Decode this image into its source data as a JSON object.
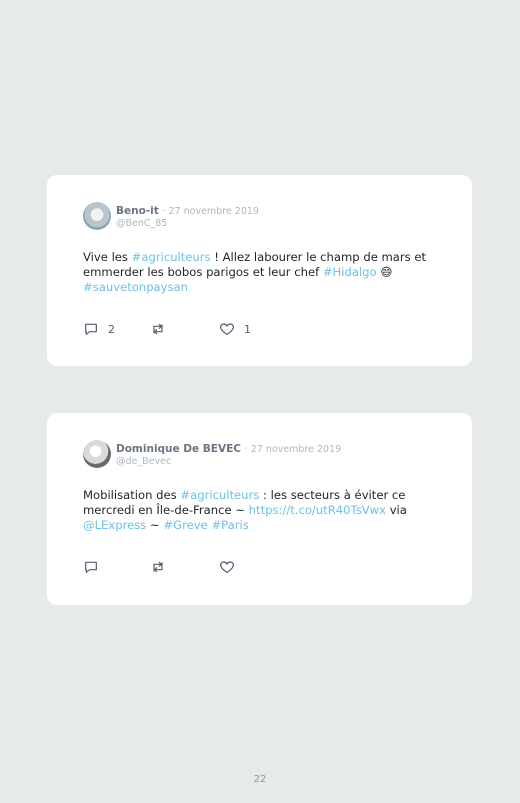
{
  "tweets": [
    {
      "author_name": "Beno-it",
      "separator": "·",
      "date": "27 novembre 2019",
      "handle": "@BenC_85",
      "text": {
        "part1": "Vive les ",
        "tag1": "#agriculteurs",
        "part2": " ! Allez labourer le champ de mars et emmerder les bobos parigos et leur chef ",
        "tag2": "#Hidalgo",
        "emoji": "😄",
        "tag3": "#sauvetonpaysan"
      },
      "reply_count": "2",
      "retweet_count": "",
      "like_count": "1"
    },
    {
      "author_name": "Dominique De BEVEC",
      "separator": "·",
      "date": "27 novembre 2019",
      "handle": "@de_Bevec",
      "text": {
        "part1": "Mobilisation des ",
        "tag1": "#agriculteurs",
        "part2": " : les secteurs à éviter ce mercredi en Île-de-France ~ ",
        "link": "https://t.co/utR40TsVwx",
        "part3": " via ",
        "mention": "@LExpress",
        "part4": " ~ ",
        "tag2": "#Greve",
        "tag3": "#Paris"
      },
      "reply_count": "",
      "retweet_count": "",
      "like_count": ""
    }
  ],
  "icons": {
    "reply": "reply-icon",
    "retweet": "retweet-icon",
    "like": "heart-icon"
  },
  "colors": {
    "background": "#e6ebe9",
    "card": "#ffffff",
    "link": "#6fc0e8",
    "muted": "#b0b7bf",
    "author": "#6a7582"
  },
  "page_number": "22"
}
